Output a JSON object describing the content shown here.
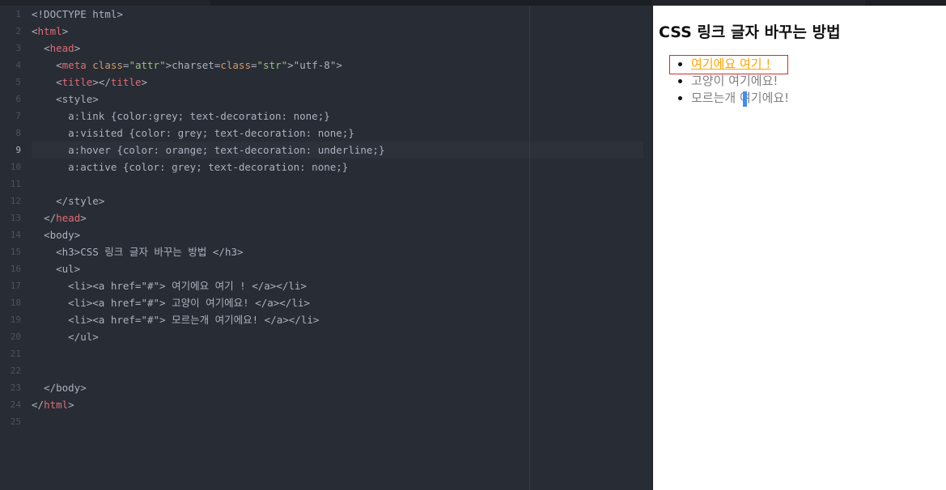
{
  "editor": {
    "active_line": 9,
    "lines": [
      {
        "n": "1",
        "text": "<!DOCTYPE html>"
      },
      {
        "n": "2",
        "text": "<html>"
      },
      {
        "n": "3",
        "text": "  <head>"
      },
      {
        "n": "4",
        "text": "    <meta charset=\"utf-8\">"
      },
      {
        "n": "5",
        "text": "    <title></title>"
      },
      {
        "n": "6",
        "text": "    <style>"
      },
      {
        "n": "7",
        "text": "      a:link {color:grey; text-decoration: none;}"
      },
      {
        "n": "8",
        "text": "      a:visited {color: grey; text-decoration: none;}"
      },
      {
        "n": "9",
        "text": "      a:hover {color: orange; text-decoration: underline;}"
      },
      {
        "n": "10",
        "text": "      a:active {color: grey; text-decoration: none;}"
      },
      {
        "n": "11",
        "text": ""
      },
      {
        "n": "12",
        "text": "    </style>"
      },
      {
        "n": "13",
        "text": "  </head>"
      },
      {
        "n": "14",
        "text": "  <body>"
      },
      {
        "n": "15",
        "text": "    <h3>CSS 링크 글자 바꾸는 방법 </h3>"
      },
      {
        "n": "16",
        "text": "    <ul>"
      },
      {
        "n": "17",
        "text": "      <li><a href=\"#\"> 여기에요 여기 ! </a></li>"
      },
      {
        "n": "18",
        "text": "      <li><a href=\"#\"> 고양이 여기에요! </a></li>"
      },
      {
        "n": "19",
        "text": "      <li><a href=\"#\"> 모르는개 여기에요! </a></li>"
      },
      {
        "n": "20",
        "text": "      </ul>"
      },
      {
        "n": "21",
        "text": ""
      },
      {
        "n": "22",
        "text": ""
      },
      {
        "n": "23",
        "text": "  </body>"
      },
      {
        "n": "24",
        "text": "</html>"
      },
      {
        "n": "25",
        "text": ""
      }
    ]
  },
  "preview": {
    "title": "CSS 링크 글자 바꾸는 방법",
    "links": [
      {
        "label": "여기에요 여기 !",
        "state": "hover"
      },
      {
        "label": "고양이 여기에요!",
        "state": "normal"
      },
      {
        "label": "모르는개 여기에요!",
        "state": "normal"
      }
    ]
  },
  "colors": {
    "editor_bg": "#282c34",
    "tag": "#e06c75",
    "attribute": "#d19a66",
    "string": "#98c379",
    "link": "grey",
    "link_hover": "orange",
    "hover_outline": "#d62b2b",
    "caret": "#3e8ef7"
  }
}
